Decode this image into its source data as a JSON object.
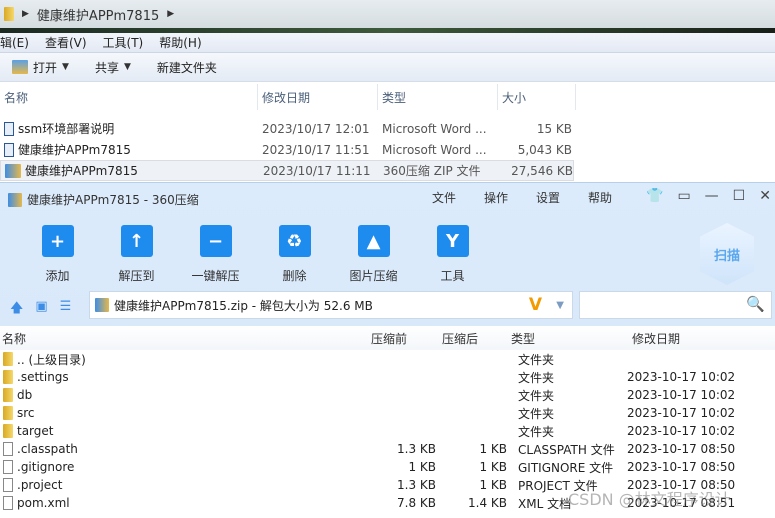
{
  "explorer": {
    "breadcrumb": "健康维护APPm7815",
    "menu": [
      "编辑(E)",
      "查看(V)",
      "工具(T)",
      "帮助(H)"
    ],
    "toolbar": {
      "open": "打开",
      "share": "共享",
      "new_folder": "新建文件夹"
    },
    "columns": [
      "名称",
      "修改日期",
      "类型",
      "大小"
    ],
    "files": [
      {
        "name": "ssm环境部署说明",
        "date": "2023/10/17 12:01",
        "type": "Microsoft Word ...",
        "size": "15 KB",
        "icon": "word-doc-icon"
      },
      {
        "name": "健康维护APPm7815",
        "date": "2023/10/17 11:51",
        "type": "Microsoft Word ...",
        "size": "5,043 KB",
        "icon": "word-doc-icon"
      },
      {
        "name": "健康维护APPm7815",
        "date": "2023/10/17 11:11",
        "type": "360压缩 ZIP 文件",
        "size": "27,546 KB",
        "icon": "zip-icon"
      }
    ]
  },
  "zipapp": {
    "title": "健康维护APPm7815 - 360压缩",
    "menu": [
      "文件",
      "操作",
      "设置",
      "帮助"
    ],
    "tools": [
      {
        "label": "添加",
        "icon": "add-folder-icon",
        "glyph": "+"
      },
      {
        "label": "解压到",
        "icon": "extract-to-icon",
        "glyph": "↑"
      },
      {
        "label": "一键解压",
        "icon": "one-click-extract-icon",
        "glyph": "−"
      },
      {
        "label": "删除",
        "icon": "recycle-bin-icon",
        "glyph": "♻"
      },
      {
        "label": "图片压缩",
        "icon": "image-compress-icon",
        "glyph": "▲"
      },
      {
        "label": "工具",
        "icon": "tools-icon",
        "glyph": "Y"
      }
    ],
    "scan": "扫描",
    "path": "健康维护APPm7815.zip - 解包大小为 52.6 MB",
    "columns": [
      "名称",
      "压缩前",
      "压缩后",
      "类型",
      "修改日期"
    ],
    "rows": [
      {
        "name": ".. (上级目录)",
        "before": "",
        "after": "",
        "type": "文件夹",
        "date": "",
        "kind": "folder"
      },
      {
        "name": ".settings",
        "before": "",
        "after": "",
        "type": "文件夹",
        "date": "2023-10-17 10:02",
        "kind": "folder"
      },
      {
        "name": "db",
        "before": "",
        "after": "",
        "type": "文件夹",
        "date": "2023-10-17 10:02",
        "kind": "folder"
      },
      {
        "name": "src",
        "before": "",
        "after": "",
        "type": "文件夹",
        "date": "2023-10-17 10:02",
        "kind": "folder"
      },
      {
        "name": "target",
        "before": "",
        "after": "",
        "type": "文件夹",
        "date": "2023-10-17 10:02",
        "kind": "folder"
      },
      {
        "name": ".classpath",
        "before": "1.3 KB",
        "after": "1 KB",
        "type": "CLASSPATH 文件",
        "date": "2023-10-17 08:50",
        "kind": "file"
      },
      {
        "name": ".gitignore",
        "before": "1 KB",
        "after": "1 KB",
        "type": "GITIGNORE 文件",
        "date": "2023-10-17 08:50",
        "kind": "file"
      },
      {
        "name": ".project",
        "before": "1.3 KB",
        "after": "1 KB",
        "type": "PROJECT 文件",
        "date": "2023-10-17 08:50",
        "kind": "file"
      },
      {
        "name": "pom.xml",
        "before": "7.8 KB",
        "after": "1.4 KB",
        "type": "XML 文档",
        "date": "2023-10-17 08:51",
        "kind": "file"
      }
    ]
  },
  "watermark": "CSDN @林文程序设计"
}
